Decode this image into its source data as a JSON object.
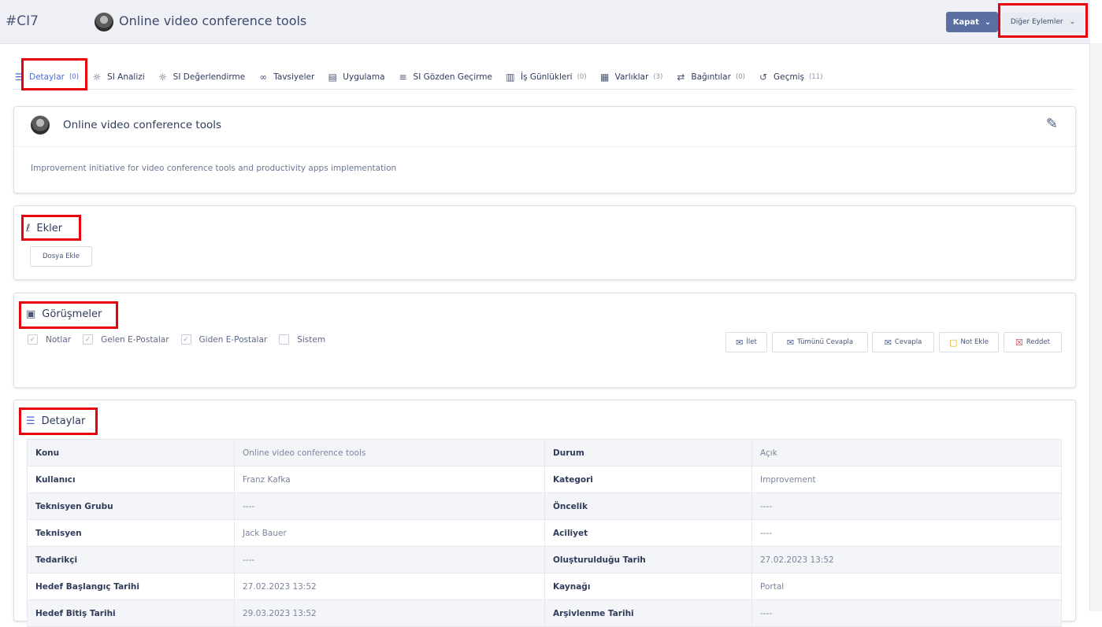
{
  "header": {
    "ticket_id": "#CI7",
    "title": "Online video conference tools",
    "close_button": "Kapat",
    "more_actions": "Diğer Eylemler"
  },
  "tabs": [
    {
      "label": "Detaylar",
      "count": "(0)",
      "icon": "list-icon"
    },
    {
      "label": "SI Analizi",
      "count": "",
      "icon": "bulb-icon"
    },
    {
      "label": "SI Değerlendirme",
      "count": "",
      "icon": "bulb-icon"
    },
    {
      "label": "Tavsiyeler",
      "count": "",
      "icon": "link-icon"
    },
    {
      "label": "Uygulama",
      "count": "",
      "icon": "clipboard-icon"
    },
    {
      "label": "SI Gözden Geçirme",
      "count": "",
      "icon": "layers-icon"
    },
    {
      "label": "İş Günlükleri",
      "count": "(0)",
      "icon": "worklog-icon"
    },
    {
      "label": "Varlıklar",
      "count": "(3)",
      "icon": "asset-icon"
    },
    {
      "label": "Bağıntılar",
      "count": "(0)",
      "icon": "relation-icon"
    },
    {
      "label": "Geçmiş",
      "count": "(11)",
      "icon": "history-icon"
    }
  ],
  "summary": {
    "title": "Online video conference tools",
    "description": "Improvement initiative for video conference tools and productivity apps implementation"
  },
  "attachments": {
    "title": "Ekler",
    "add_file": "Dosya Ekle"
  },
  "conversations": {
    "title": "Görüşmeler",
    "filters": [
      {
        "label": "Notlar",
        "checked": true
      },
      {
        "label": "Gelen E-Postalar",
        "checked": true
      },
      {
        "label": "Giden E-Postalar",
        "checked": true
      },
      {
        "label": "Sistem",
        "checked": false
      }
    ],
    "actions": {
      "forward": "İlet",
      "reply_all": "Tümünü Cevapla",
      "reply": "Cevapla",
      "add_note": "Not Ekle",
      "reject": "Reddet"
    }
  },
  "details": {
    "title": "Detaylar",
    "rows": [
      [
        "Konu",
        "Online video conference tools",
        "Durum",
        "Açık"
      ],
      [
        "Kullanıcı",
        "Franz Kafka",
        "Kategori",
        "Improvement"
      ],
      [
        "Teknisyen Grubu",
        "----",
        "Öncelik",
        "----"
      ],
      [
        "Teknisyen",
        "Jack Bauer",
        "Aciliyet",
        "----"
      ],
      [
        "Tedarikçi",
        "----",
        "Oluşturulduğu Tarih",
        "27.02.2023 13:52"
      ],
      [
        "Hedef Başlangıç Tarihi",
        "27.02.2023 13:52",
        "Kaynağı",
        "Portal"
      ],
      [
        "Hedef Bitiş Tarihi",
        "29.03.2023 13:52",
        "Arşivlenme Tarihi",
        "----"
      ]
    ]
  },
  "colors": {
    "accent": "#4e6ad7",
    "primary_button": "#5b6fa3",
    "highlight": "#e8000b"
  }
}
